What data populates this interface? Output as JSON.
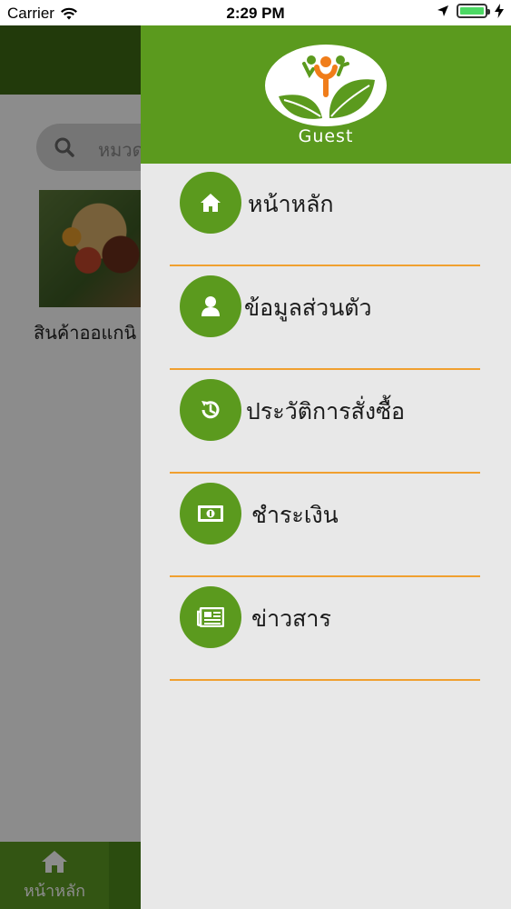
{
  "status_bar": {
    "carrier": "Carrier",
    "time": "2:29 PM",
    "battery_level": 1.0
  },
  "background": {
    "search_placeholder": "หมวด",
    "product_caption": "สินค้าออแกนิ",
    "bottom_tab_label": "หน้าหลัก"
  },
  "drawer": {
    "user_label": "Guest",
    "menu": [
      {
        "label": "หน้าหลัก",
        "icon": "home-icon"
      },
      {
        "label": "ข้อมูลส่วนตัว",
        "icon": "user-icon"
      },
      {
        "label": "ประวัติการสั่งซื้อ",
        "icon": "history-icon"
      },
      {
        "label": "ชำระเงิน",
        "icon": "money-icon"
      },
      {
        "label": "ข่าวสาร",
        "icon": "newspaper-icon"
      }
    ]
  },
  "colors": {
    "brand_green": "#5b9a1e",
    "divider_orange": "#f0a030",
    "drawer_bg": "#e8e8e8"
  }
}
